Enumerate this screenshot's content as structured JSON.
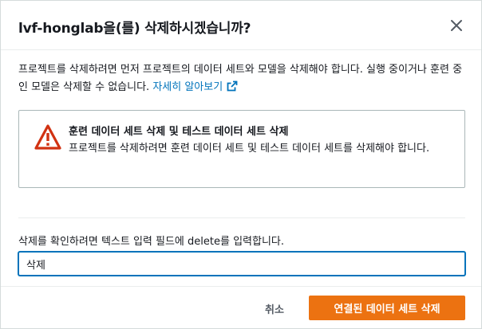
{
  "modal": {
    "title": "lvf-honglab을(를) 삭제하시겠습니까?",
    "close_icon": "close-icon",
    "description": "프로젝트를 삭제하려면 먼저 프로젝트의 데이터 세트와 모델을 삭제해야 합니다. 실행 중이거나 훈련 중인 모델은 삭제할 수 없습니다. ",
    "learn_more_label": "자세히 알아보기",
    "learn_more_icon": "external-link-icon"
  },
  "alert": {
    "icon": "warning-icon",
    "heading": "훈련 데이터 세트 삭제 및 테스트 데이터 세트 삭제",
    "body": "프로젝트를 삭제하려면 훈련 데이터 세트 및 테스트 데이터 세트를 삭제해야 합니다."
  },
  "confirmation": {
    "label": "삭제를 확인하려면 텍스트 입력 필드에 delete를 입력합니다.",
    "input_value": "삭제"
  },
  "footer": {
    "cancel_label": "취소",
    "delete_label": "연결된 데이터 세트 삭제"
  },
  "colors": {
    "primary_button": "#ec7211",
    "link": "#0073bb",
    "warning": "#d13212",
    "focus_border": "#0073bb"
  }
}
